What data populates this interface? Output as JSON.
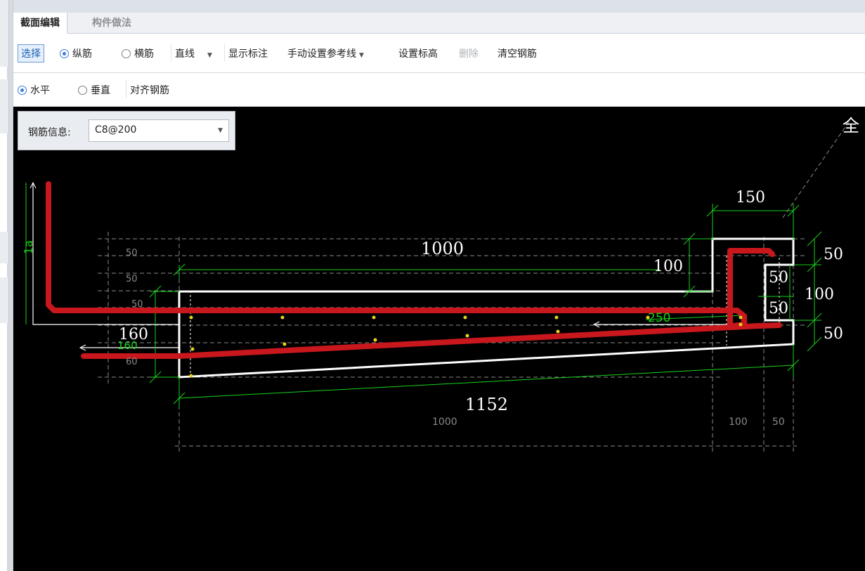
{
  "tabs": {
    "section_edit": "截面编辑",
    "component_method": "构件做法"
  },
  "toolbar1": {
    "select": "选择",
    "longitudinal": "纵筋",
    "transverse": "横筋",
    "line_type": "直线",
    "show_annotation": "显示标注",
    "manual_reference": "手动设置参考线",
    "set_elevation": "设置标高",
    "delete": "删除",
    "clear_rebar": "清空钢筋"
  },
  "toolbar2": {
    "horizontal": "水平",
    "vertical": "垂直",
    "align_rebar": "对齐钢筋"
  },
  "rebar_info": {
    "label": "钢筋信息:",
    "value": "C8@200"
  },
  "drawing": {
    "dims_main": {
      "top_width": "1000",
      "bottom_length": "1152",
      "left_height": "160",
      "tab_width": "150",
      "step_height": "100"
    },
    "dims_right": {
      "top": "50",
      "mid": "100",
      "bottom": "50",
      "inner_top": "50",
      "inner_bottom": "50"
    },
    "dims_ref": {
      "row1": "50",
      "row2": "50",
      "row3": "50",
      "row4": "60",
      "base_1000": "1000",
      "base_100": "100",
      "base_50": "50"
    },
    "anchor_label": "1a",
    "rebar_spacing": "250",
    "corner_text": "全",
    "overlap_text": "160"
  },
  "colors": {
    "rebar": "#c8171d",
    "outline": "#ffffff",
    "dimension": "#17d21a",
    "reference": "#8a8a8a",
    "node": "#e8d21c"
  }
}
